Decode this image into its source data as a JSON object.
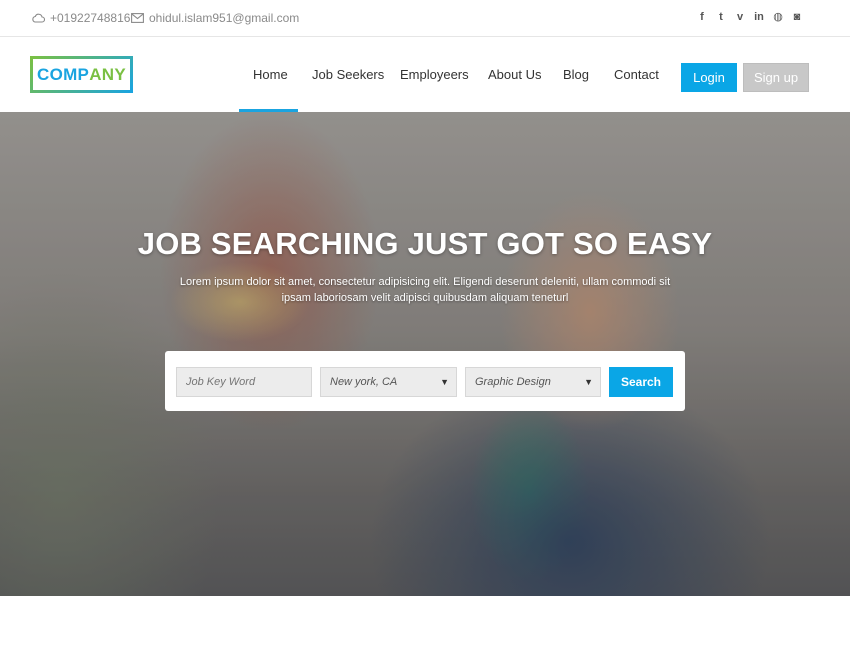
{
  "topbar": {
    "phone": "+01922748816",
    "email": "ohidul.islam951@gmail.com",
    "phone_icon": "cloud-icon",
    "email_icon": "envelope-icon",
    "socials": [
      {
        "icon": "facebook-icon",
        "glyph": "f"
      },
      {
        "icon": "twitter-icon",
        "glyph": "t"
      },
      {
        "icon": "vimeo-icon",
        "glyph": "v"
      },
      {
        "icon": "linkedin-icon",
        "glyph": "in"
      },
      {
        "icon": "dribbble-icon",
        "glyph": "◍"
      },
      {
        "icon": "instagram-icon",
        "glyph": "◙"
      }
    ]
  },
  "header": {
    "logo_part1": "COMP",
    "logo_part2": "ANY",
    "nav": [
      "Home",
      "Job Seekers",
      "Employeers",
      "About Us",
      "Blog",
      "Contact"
    ],
    "active_nav": "Home",
    "login_label": "Login",
    "signup_label": "Sign up"
  },
  "hero": {
    "title": "JOB SEARCHING JUST GOT SO EASY",
    "subtitle": "Lorem ipsum dolor sit amet, consectetur adipisicing elit. Eligendi deserunt deleniti, ullam commodi sit ipsam laboriosam velit adipisci quibusdam aliquam teneturl"
  },
  "search": {
    "keyword_placeholder": "Job Key Word",
    "location_value": "New york, CA",
    "category_value": "Graphic Design",
    "button_label": "Search"
  },
  "colors": {
    "accent": "#0aa6e6",
    "logo_blue": "#1aa4e0",
    "logo_green": "#7ac043",
    "signup_gray": "#c8c8c8"
  }
}
